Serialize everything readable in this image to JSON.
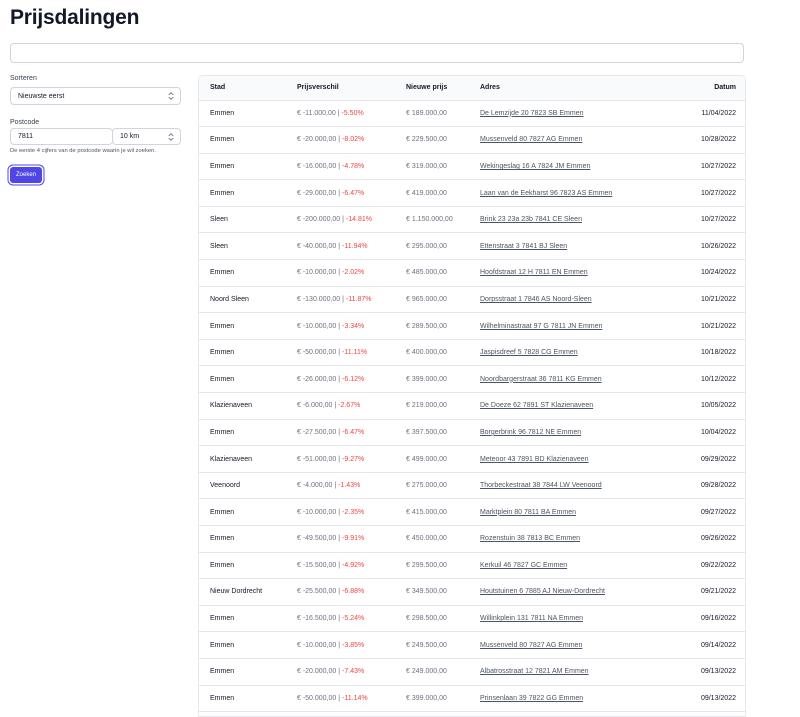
{
  "page": {
    "title": "Prijsdalingen"
  },
  "search": {
    "value": "",
    "placeholder": ""
  },
  "filters": {
    "sort_label": "Sorteren",
    "sort_value": "Nieuwste eerst",
    "postcode_label": "Postcode",
    "postcode_value": "7811",
    "distance_value": "10 km",
    "hint": "De eerste 4 cijfers van de postcode waarin je wil zoeken.",
    "submit_label": "Zoeken"
  },
  "table": {
    "headers": {
      "city": "Stad",
      "price_diff": "Prijsverschil",
      "new_price": "Nieuwe prijs",
      "address": "Adres",
      "date": "Datum"
    },
    "rows": [
      {
        "city": "Emmen",
        "diff": "€ -11.000,00",
        "pct": "-5.50%",
        "new_price": "€ 189.000,00",
        "address": "De Lemzijde 20 7823 SB Emmen",
        "date": "11/04/2022"
      },
      {
        "city": "Emmen",
        "diff": "€ -20.000,00",
        "pct": "-8.02%",
        "new_price": "€ 229.500,00",
        "address": "Mussenveld 80 7827 AG Emmen",
        "date": "10/28/2022"
      },
      {
        "city": "Emmen",
        "diff": "€ -16.000,00",
        "pct": "-4.78%",
        "new_price": "€ 319.000,00",
        "address": "Wekingeslag 16 A 7824 JM Emmen",
        "date": "10/27/2022"
      },
      {
        "city": "Emmen",
        "diff": "€ -29.000,00",
        "pct": "-6.47%",
        "new_price": "€ 419.000,00",
        "address": "Laan van de Eekharst 96 7823 AS Emmen",
        "date": "10/27/2022"
      },
      {
        "city": "Sleen",
        "diff": "€ -200.000,00",
        "pct": "-14.81%",
        "new_price": "€ 1.150.000,00",
        "address": "Brink 23 23a 23b 7841 CE Sleen",
        "date": "10/27/2022"
      },
      {
        "city": "Sleen",
        "diff": "€ -40.000,00",
        "pct": "-11.94%",
        "new_price": "€ 295.000,00",
        "address": "Ettenstraat 3 7841 BJ Sleen",
        "date": "10/26/2022"
      },
      {
        "city": "Emmen",
        "diff": "€ -10.000,00",
        "pct": "-2.02%",
        "new_price": "€ 485.000,00",
        "address": "Hoofdstraat 12 H 7811 EN Emmen",
        "date": "10/24/2022"
      },
      {
        "city": "Noord Sleen",
        "diff": "€ -130.000,00",
        "pct": "-11.87%",
        "new_price": "€ 965.000,00",
        "address": "Dorpsstraat 1 7846 AS Noord-Sleen",
        "date": "10/21/2022"
      },
      {
        "city": "Emmen",
        "diff": "€ -10.000,00",
        "pct": "-3.34%",
        "new_price": "€ 289.500,00",
        "address": "Wilhelminastraat 97 G 7811 JN Emmen",
        "date": "10/21/2022"
      },
      {
        "city": "Emmen",
        "diff": "€ -50.000,00",
        "pct": "-11.11%",
        "new_price": "€ 400.000,00",
        "address": "Jaspisdreef 5 7828 CG Emmen",
        "date": "10/18/2022"
      },
      {
        "city": "Emmen",
        "diff": "€ -26.000,00",
        "pct": "-6.12%",
        "new_price": "€ 399.000,00",
        "address": "Noordbargerstraat 36 7811 KG Emmen",
        "date": "10/12/2022"
      },
      {
        "city": "Klazienaveen",
        "diff": "€ -6.000,00",
        "pct": "-2.67%",
        "new_price": "€ 219.000,00",
        "address": "De Doeze 62 7891 ST Klazienaveen",
        "date": "10/05/2022"
      },
      {
        "city": "Emmen",
        "diff": "€ -27.500,00",
        "pct": "-6.47%",
        "new_price": "€ 397.500,00",
        "address": "Borgerbrink 96 7812 NE Emmen",
        "date": "10/04/2022"
      },
      {
        "city": "Klazienaveen",
        "diff": "€ -51.000,00",
        "pct": "-9.27%",
        "new_price": "€ 499.000,00",
        "address": "Meteoor 43 7891 BD Klazienaveen",
        "date": "09/29/2022"
      },
      {
        "city": "Veenoord",
        "diff": "€ -4.000,00",
        "pct": "-1.43%",
        "new_price": "€ 275.000,00",
        "address": "Thorbeckestraat 38 7844 LW Veenoord",
        "date": "09/28/2022"
      },
      {
        "city": "Emmen",
        "diff": "€ -10.000,00",
        "pct": "-2.35%",
        "new_price": "€ 415.000,00",
        "address": "Marktplein 80 7811 BA Emmen",
        "date": "09/27/2022"
      },
      {
        "city": "Emmen",
        "diff": "€ -49.500,00",
        "pct": "-9.91%",
        "new_price": "€ 450.000,00",
        "address": "Rozenstuin 38 7813 BC Emmen",
        "date": "09/26/2022"
      },
      {
        "city": "Emmen",
        "diff": "€ -15.500,00",
        "pct": "-4.92%",
        "new_price": "€ 299.500,00",
        "address": "Kerkuil 46 7827 GC Emmen",
        "date": "09/22/2022"
      },
      {
        "city": "Nieuw Dordrecht",
        "diff": "€ -25.500,00",
        "pct": "-6.88%",
        "new_price": "€ 349.500,00",
        "address": "Houtstuinen 6 7885 AJ Nieuw-Dordrecht",
        "date": "09/21/2022"
      },
      {
        "city": "Emmen",
        "diff": "€ -16.500,00",
        "pct": "-5.24%",
        "new_price": "€ 298.500,00",
        "address": "Willinkplein 131 7811 NA Emmen",
        "date": "09/16/2022"
      },
      {
        "city": "Emmen",
        "diff": "€ -10.000,00",
        "pct": "-3.85%",
        "new_price": "€ 249.500,00",
        "address": "Mussenveld 80 7827 AG Emmen",
        "date": "09/14/2022"
      },
      {
        "city": "Emmen",
        "diff": "€ -20.000,00",
        "pct": "-7.43%",
        "new_price": "€ 249.000,00",
        "address": "Albatrosstraat 12 7821 AM Emmen",
        "date": "09/13/2022"
      },
      {
        "city": "Emmen",
        "diff": "€ -50.000,00",
        "pct": "-11.14%",
        "new_price": "€ 399.000,00",
        "address": "Prinsenlaan 39 7822 GG Emmen",
        "date": "09/13/2022"
      }
    ]
  }
}
